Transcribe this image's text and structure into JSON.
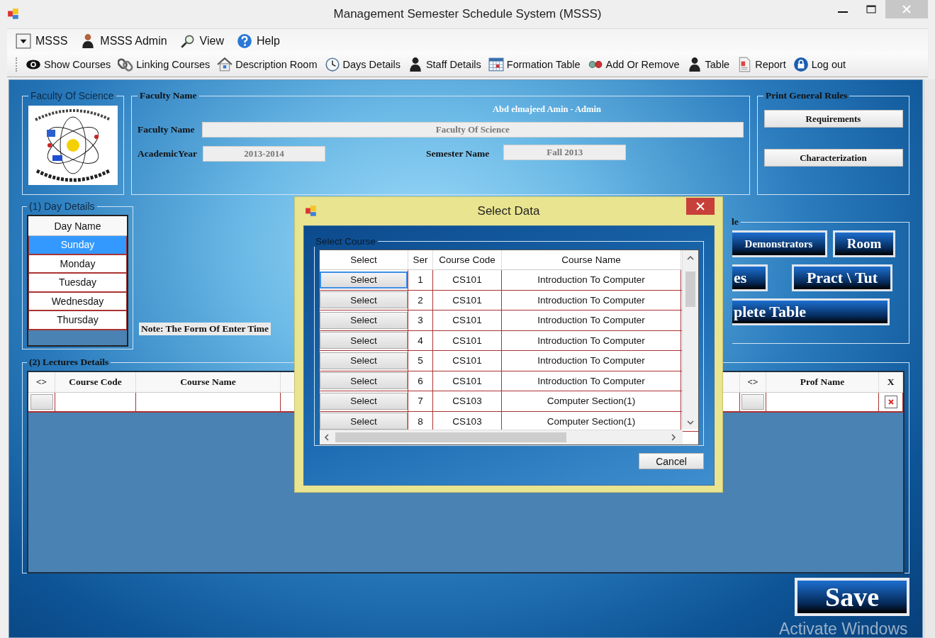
{
  "window": {
    "title": "Management Semester Schedule System (MSSS)"
  },
  "menu": [
    "MSSS",
    "MSSS Admin",
    "View",
    "Help"
  ],
  "toolbar": [
    "Show Courses",
    "Linking Courses",
    "Description Room",
    "Days Details",
    "Staff Details",
    "Formation Table",
    "Add Or Remove",
    "Table",
    "Report",
    "Log out"
  ],
  "logo_group": {
    "title": "Faculty Of Science"
  },
  "faculty_group": {
    "title": "Faculty Name",
    "user": "Abd elmajeed Amin - Admin",
    "faculty_label": "Faculty Name",
    "faculty_value": "Faculty Of Science",
    "year_label": "AcademicYear",
    "year_value": "2013-2014",
    "semester_label": "Semester Name",
    "semester_value": "Fall 2013"
  },
  "print_rules": {
    "title": "Print General Rules",
    "buttons": [
      "Requirements",
      "Characterization"
    ]
  },
  "day_details": {
    "title": "(1) Day Details",
    "header": "Day Name",
    "days": [
      {
        "name": "Sunday",
        "selected": true
      },
      {
        "name": "Monday",
        "selected": false
      },
      {
        "name": "Tuesday",
        "selected": false
      },
      {
        "name": "Wednesday",
        "selected": false
      },
      {
        "name": "Thursday",
        "selected": false
      }
    ]
  },
  "note": "Note: The Form Of Enter Time",
  "table_group": {
    "title": "le",
    "rows": [
      [
        "Demonstrators",
        "Room"
      ],
      [
        "es",
        "Pract \\ Tut"
      ],
      [
        "plete Table"
      ]
    ]
  },
  "lectures": {
    "title": "(2) Lectures Details",
    "columns_left": [
      "<>",
      "Course Code",
      "Course Name"
    ],
    "columns_right": [
      "<>",
      "Prof Name",
      "X"
    ]
  },
  "save": "Save",
  "os_notice": "Activate Windows",
  "dialog": {
    "title": "Select Data",
    "group": "Select Course",
    "columns": [
      "Select",
      "Ser",
      "Course Code",
      "Course Name"
    ],
    "rows": [
      {
        "button": "Select",
        "ser": "1",
        "code": "CS101",
        "name": "Introduction To Computer",
        "selected": true
      },
      {
        "button": "Select",
        "ser": "2",
        "code": "CS101",
        "name": "Introduction To Computer",
        "selected": false
      },
      {
        "button": "Select",
        "ser": "3",
        "code": "CS101",
        "name": "Introduction To Computer",
        "selected": false
      },
      {
        "button": "Select",
        "ser": "4",
        "code": "CS101",
        "name": "Introduction To Computer",
        "selected": false
      },
      {
        "button": "Select",
        "ser": "5",
        "code": "CS101",
        "name": "Introduction To Computer",
        "selected": false
      },
      {
        "button": "Select",
        "ser": "6",
        "code": "CS101",
        "name": "Introduction To Computer",
        "selected": false
      },
      {
        "button": "Select",
        "ser": "7",
        "code": "CS103",
        "name": "Computer Section(1)",
        "selected": false
      },
      {
        "button": "Select",
        "ser": "8",
        "code": "CS103",
        "name": "Computer Section(1)",
        "selected": false
      }
    ],
    "cancel": "Cancel"
  }
}
